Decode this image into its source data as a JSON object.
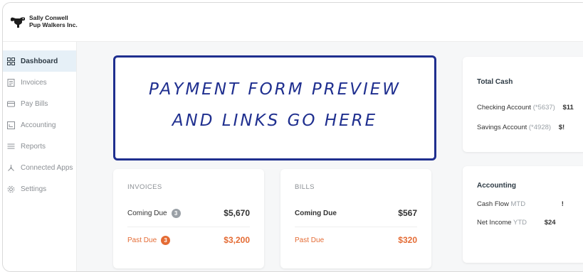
{
  "brand": {
    "line1": "Sally Conwell",
    "line2": "Pup Walkers Inc."
  },
  "sidebar": {
    "items": [
      {
        "label": "Dashboard",
        "icon": "dashboard-grid-icon"
      },
      {
        "label": "Invoices",
        "icon": "invoice-icon"
      },
      {
        "label": "Pay Bills",
        "icon": "card-icon"
      },
      {
        "label": "Accounting",
        "icon": "ledger-icon"
      },
      {
        "label": "Reports",
        "icon": "reports-icon"
      },
      {
        "label": "Connected Apps",
        "icon": "connected-apps-icon"
      },
      {
        "label": "Settings",
        "icon": "gear-icon"
      }
    ]
  },
  "overlay": {
    "line1": "PAYMENT FORM PREVIEW",
    "line2": "AND LINKS GO HERE"
  },
  "invoices": {
    "title": "INVOICES",
    "coming_due_label": "Coming Due",
    "coming_due_count": "3",
    "coming_due_value": "$5,670",
    "past_due_label": "Past Due",
    "past_due_count": "3",
    "past_due_value": "$3,200"
  },
  "bills": {
    "title": "BILLS",
    "coming_due_label": "Coming Due",
    "coming_due_value": "$567",
    "past_due_label": "Past Due",
    "past_due_value": "$320"
  },
  "total_cash": {
    "title": "Total Cash",
    "checking_label": "Checking Account",
    "checking_acct": "(*5637)",
    "checking_value": "$11",
    "savings_label": "Savings Account",
    "savings_acct": "(*4928)",
    "savings_value": "$!"
  },
  "accounting": {
    "title": "Accounting",
    "cash_flow_label": "Cash Flow",
    "cash_flow_period": "MTD",
    "cash_flow_value": "!",
    "net_income_label": "Net Income",
    "net_income_period": "YTD",
    "net_income_value": "$24"
  },
  "colors": {
    "accent": "#e46b34",
    "overlay_ink": "#1f2f8f",
    "active_nav": "#e6f0f7"
  }
}
